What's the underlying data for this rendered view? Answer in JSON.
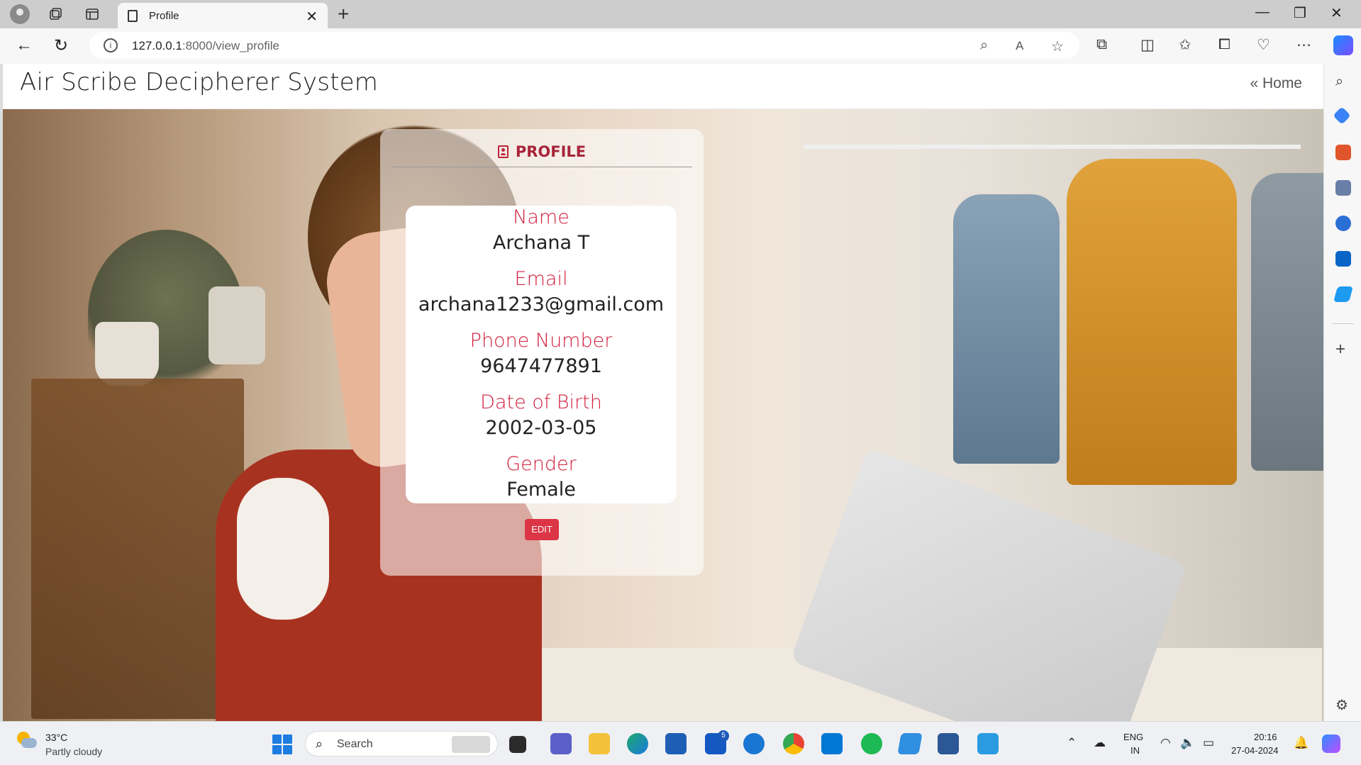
{
  "browser": {
    "tab_title": "Profile",
    "url_host": "127.0.0.1",
    "url_path": ":8000/view_profile",
    "window_controls": [
      "—",
      "❐",
      "✕"
    ]
  },
  "site": {
    "title": "Air Scribe Decipherer System",
    "home_link": "Home"
  },
  "profile": {
    "heading": "PROFILE",
    "fields": [
      {
        "label": "Name",
        "value": "Archana T"
      },
      {
        "label": "Email",
        "value": "archana1233@gmail.com"
      },
      {
        "label": "Phone Number",
        "value": "9647477891"
      },
      {
        "label": "Date of Birth",
        "value": "2002-03-05"
      },
      {
        "label": "Gender",
        "value": "Female"
      }
    ],
    "edit_label": "EDIT",
    "accent_color": "#d01e3c",
    "button_color": "#dc3545"
  },
  "taskbar": {
    "weather_temp": "33°C",
    "weather_desc": "Partly cloudy",
    "search_placeholder": "Search",
    "outlook_badge": "5",
    "lang_top": "ENG",
    "lang_bottom": "IN",
    "time": "20:16",
    "date": "27-04-2024"
  }
}
